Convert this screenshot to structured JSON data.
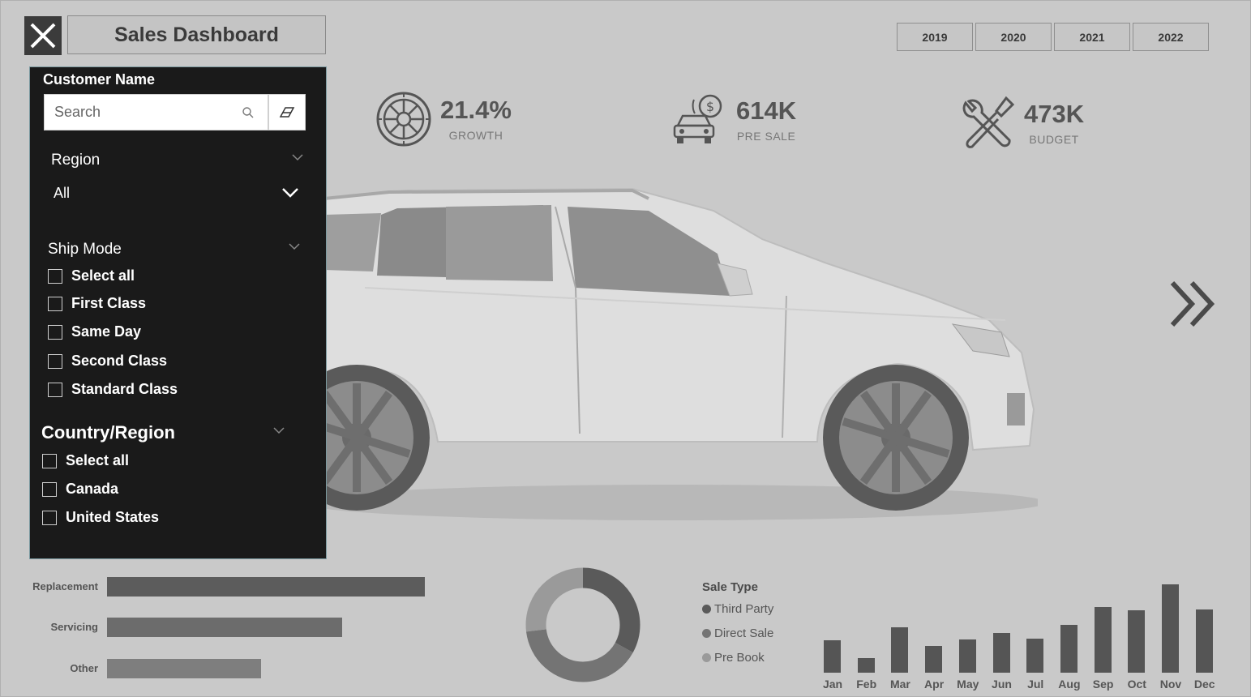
{
  "header": {
    "title": "Sales Dashboard",
    "years": [
      "2019",
      "2020",
      "2021",
      "2022"
    ]
  },
  "kpis": [
    {
      "icon": "tire-icon",
      "value": "21.4%",
      "label": "GROWTH"
    },
    {
      "icon": "car-dollar-icon",
      "value": "614K",
      "label": "PRE SALE"
    },
    {
      "icon": "tools-icon",
      "value": "473K",
      "label": "BUDGET"
    }
  ],
  "filters": {
    "customer_name": {
      "label": "Customer Name",
      "placeholder": "Search"
    },
    "region": {
      "label": "Region",
      "selected": "All"
    },
    "ship_mode": {
      "label": "Ship Mode",
      "options": [
        "Select all",
        "First Class",
        "Same Day",
        "Second Class",
        "Standard Class"
      ]
    },
    "country_region": {
      "label": "Country/Region",
      "options": [
        "Select all",
        "Canada",
        "United States"
      ]
    }
  },
  "colors": {
    "panel_bg": "#1a1a1a",
    "page_bg": "#c9c9c9",
    "bar_dark": "#555555",
    "donut_dark": "#5a5a5a",
    "donut_mid": "#747474",
    "donut_light": "#9a9a9a"
  },
  "service_chart": {
    "categories": [
      "Replacement",
      "Servicing",
      "Other"
    ],
    "values": [
      392,
      290,
      190
    ],
    "colors": [
      "#5c5c5c",
      "#6c6c6c",
      "#7e7e7e"
    ]
  },
  "sale_type": {
    "title": "Sale Type",
    "items": [
      {
        "name": "Third Party",
        "color": "#5a5a5a",
        "share": 0.33
      },
      {
        "name": "Direct Sale",
        "color": "#747474",
        "share": 0.4
      },
      {
        "name": "Pre Book",
        "color": "#9a9a9a",
        "share": 0.27
      }
    ]
  },
  "chart_data": {
    "type": "bar",
    "categories": [
      "Jan",
      "Feb",
      "Mar",
      "Apr",
      "May",
      "Jun",
      "Jul",
      "Aug",
      "Sep",
      "Oct",
      "Nov",
      "Dec"
    ],
    "values": [
      40,
      18,
      56,
      33,
      41,
      49,
      42,
      59,
      81,
      77,
      109,
      78
    ]
  }
}
